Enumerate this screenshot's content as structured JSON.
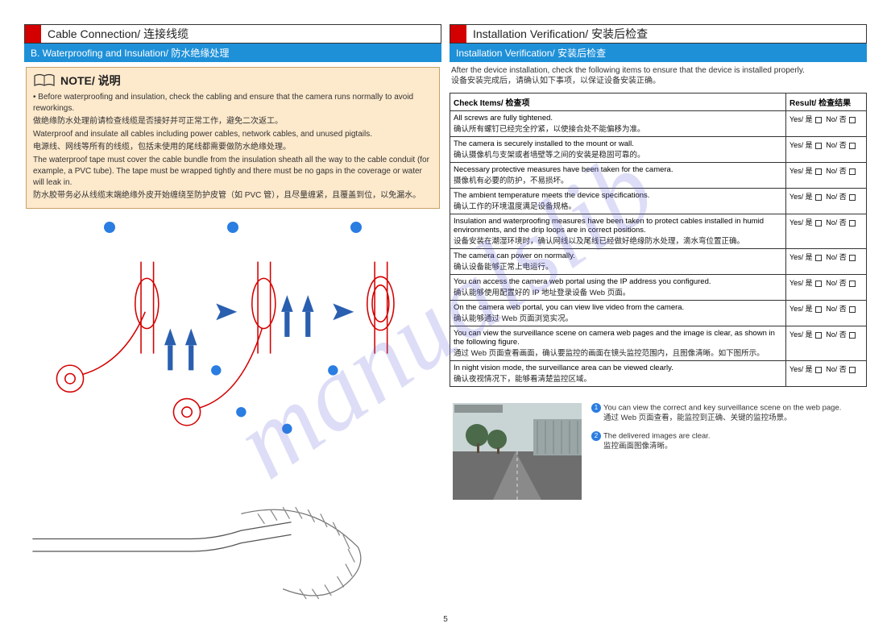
{
  "page_number": "5",
  "watermark": "manualslib",
  "left": {
    "section_title": "Cable Connection/ 连接线缆",
    "sub_header": "B. Waterproofing and Insulation/ 防水绝缘处理",
    "note_title": "NOTE/ 说明",
    "note_items": [
      "• Before waterproofing and insulation, check the cabling and ensure that the camera runs normally to avoid reworkings.",
      "做绝缘防水处理前请检查线缆是否接好并可正常工作，避免二次返工。",
      "Waterproof and insulate all cables including power cables, network cables, and unused pigtails.",
      "电源线、网线等所有的线缆，包括未使用的尾线都需要做防水绝缘处理。",
      "The waterproof tape must cover the cable bundle from the insulation sheath all the way to the cable conduit (for example, a PVC tube). The tape must be wrapped tightly and there must be no gaps in the coverage or water will leak in.",
      "防水胶带务必从线缆末端绝缘外皮开始缠绕至防护皮管（如 PVC 管），且尽量缠紧，且覆盖到位，以免漏水。"
    ]
  },
  "right": {
    "section_title": "Installation Verification/ 安装后检查",
    "sub_header": "Installation Verification/ 安装后检查",
    "intro_en": "After the device installation, check the following items to ensure that the device is installed properly.",
    "intro_zh": "设备安装完成后，请确认如下事项，以保证设备安装正确。",
    "table_headers": {
      "items": "Check Items/ 检查项",
      "result": "Result/ 检查结果"
    },
    "result_labels": {
      "yes": "Yes/ 是",
      "no": "No/ 否"
    },
    "rows": [
      {
        "en": "All screws are fully tightened.",
        "zh": "确认所有螺钉已经完全拧紧，以使接合处不能偏移为准。"
      },
      {
        "en": "The camera is securely installed to the mount or wall.",
        "zh": "确认摄像机与支架或者墙壁等之间的安装是稳固可靠的。"
      },
      {
        "en": "Necessary protective measures have been taken for the camera.",
        "zh": "摄像机有必要的防护，不易损坏。"
      },
      {
        "en": "The ambient temperature meets the device specifications.",
        "zh": "确认工作的环境温度满足设备规格。"
      },
      {
        "en": "Insulation and waterproofing measures have been taken to protect cables installed in humid environments, and the drip loops are in correct positions.",
        "zh": "设备安装在潮湿环境时，确认网线以及尾线已经做好绝缘防水处理，滴水弯位置正确。"
      },
      {
        "en": "The camera can power on normally.",
        "zh": "确认设备能够正常上电运行。"
      },
      {
        "en": "You can access the camera web portal using the IP address you configured.",
        "zh": "确认能够使用配置好的 IP 地址登录设备 Web 页面。"
      },
      {
        "en": "On the camera web portal, you can view live video from the camera.",
        "zh": "确认能够通过 Web 页面浏览实况。"
      },
      {
        "en": "You can view the surveillance scene on camera web pages and the image is clear, as shown in the following figure.",
        "zh": "通过 Web 页面查看画面，确认要监控的画面在镜头监控范围内，且图像清晰。如下图所示。"
      },
      {
        "en": "In night vision mode, the surveillance area can be viewed clearly.",
        "zh": "确认夜视情况下，能够看清楚监控区域。"
      }
    ],
    "captions": [
      {
        "num": "1",
        "en": "You can view the correct and key surveillance scene on the web page.",
        "zh": "通过 Web 页面查看，能监控到正确、关键的监控场景。"
      },
      {
        "num": "2",
        "en": "The delivered images are clear.",
        "zh": "监控画面图像清晰。"
      }
    ]
  }
}
